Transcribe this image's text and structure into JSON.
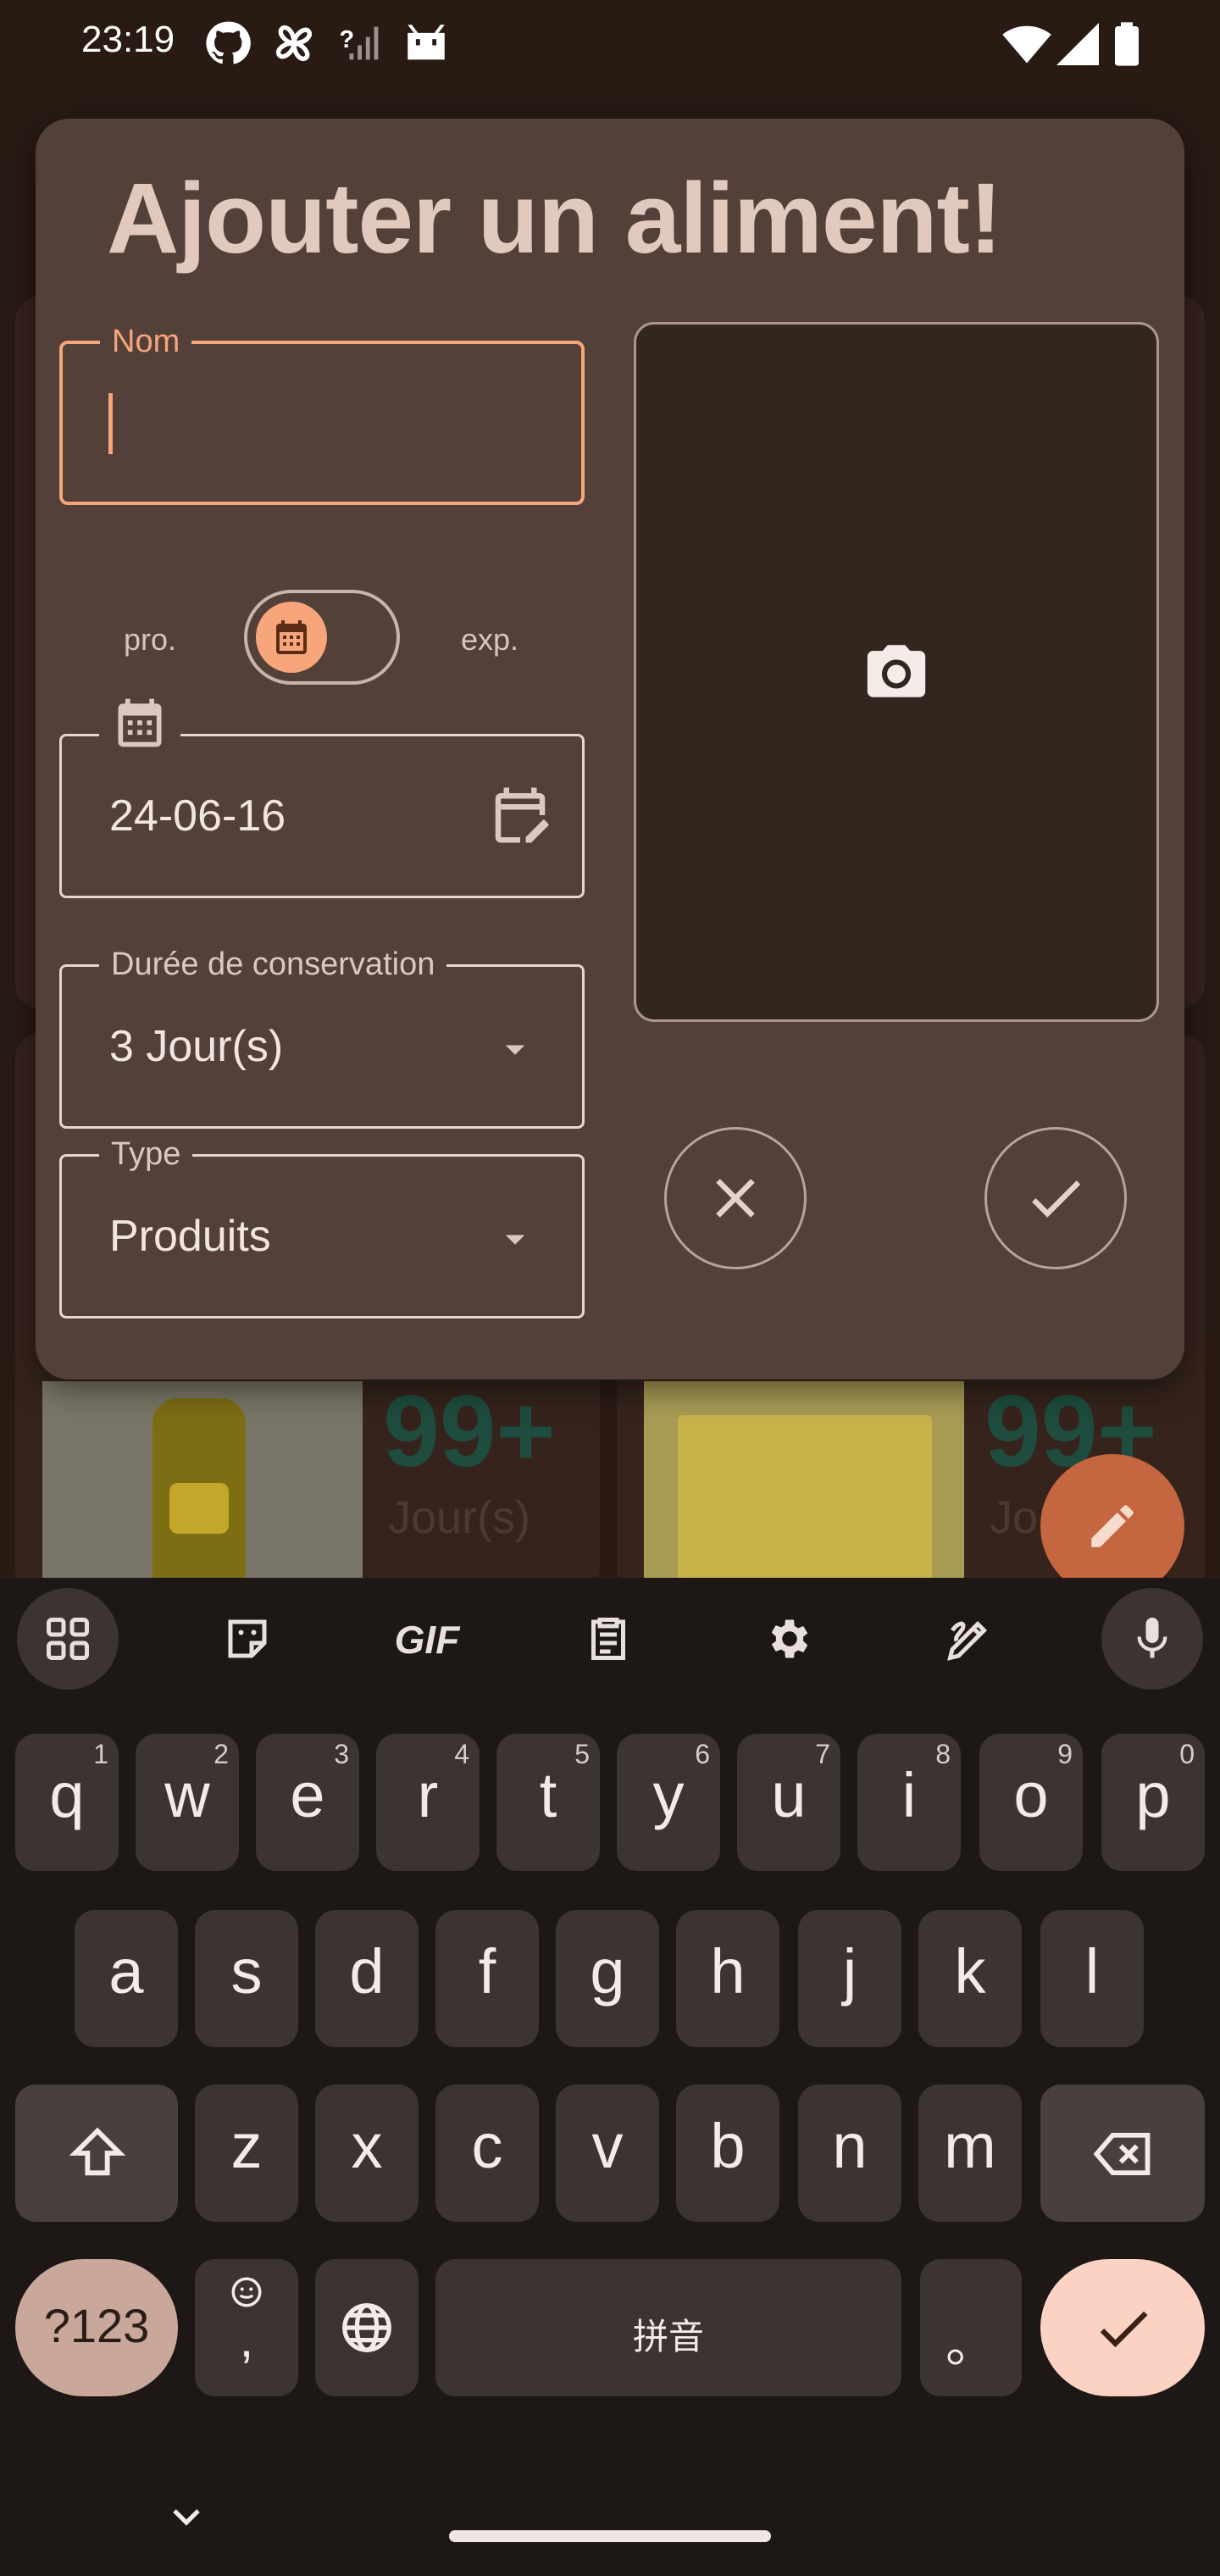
{
  "status_bar": {
    "time": "23:19",
    "left_icons": [
      "github-icon",
      "pinwheel-icon",
      "no-signal-icon",
      "android-icon"
    ],
    "right_icons": [
      "wifi-icon",
      "signal-icon",
      "battery-icon"
    ]
  },
  "background_app": {
    "cards": [
      {
        "count": "99+",
        "unit": "Jour(s)"
      },
      {
        "count": "99+",
        "unit": "Jo"
      }
    ],
    "fab_icon": "pencil-icon"
  },
  "dialog": {
    "title": "Ajouter un aliment!",
    "name_field": {
      "label": "Nom",
      "value": ""
    },
    "date_toggle": {
      "left_label": "pro.",
      "right_label": "exp.",
      "thumb_icon": "calendar-icon"
    },
    "date_field": {
      "value": "24-06-16",
      "leading_icon": "calendar-icon",
      "trailing_icon": "edit-calendar-icon"
    },
    "duration_field": {
      "label": "Durée de conservation",
      "value": "3 Jour(s)"
    },
    "type_field": {
      "label": "Type",
      "value": "Produits"
    },
    "photo_icon": "camera-icon",
    "cancel_icon": "close-icon",
    "confirm_icon": "check-icon"
  },
  "keyboard": {
    "toolbar": [
      "apps-grid-icon",
      "sticker-icon",
      "GIF",
      "clipboard-icon",
      "settings-icon",
      "handwriting-icon",
      "mic-icon"
    ],
    "row1": [
      {
        "k": "q",
        "h": "1"
      },
      {
        "k": "w",
        "h": "2"
      },
      {
        "k": "e",
        "h": "3"
      },
      {
        "k": "r",
        "h": "4"
      },
      {
        "k": "t",
        "h": "5"
      },
      {
        "k": "y",
        "h": "6"
      },
      {
        "k": "u",
        "h": "7"
      },
      {
        "k": "i",
        "h": "8"
      },
      {
        "k": "o",
        "h": "9"
      },
      {
        "k": "p",
        "h": "0"
      }
    ],
    "row2": [
      "a",
      "s",
      "d",
      "f",
      "g",
      "h",
      "j",
      "k",
      "l"
    ],
    "row3": [
      "z",
      "x",
      "c",
      "v",
      "b",
      "n",
      "m"
    ],
    "symbols_key": "?123",
    "emoji_comma": ",",
    "space_label": "拼音",
    "period_key": "。"
  }
}
